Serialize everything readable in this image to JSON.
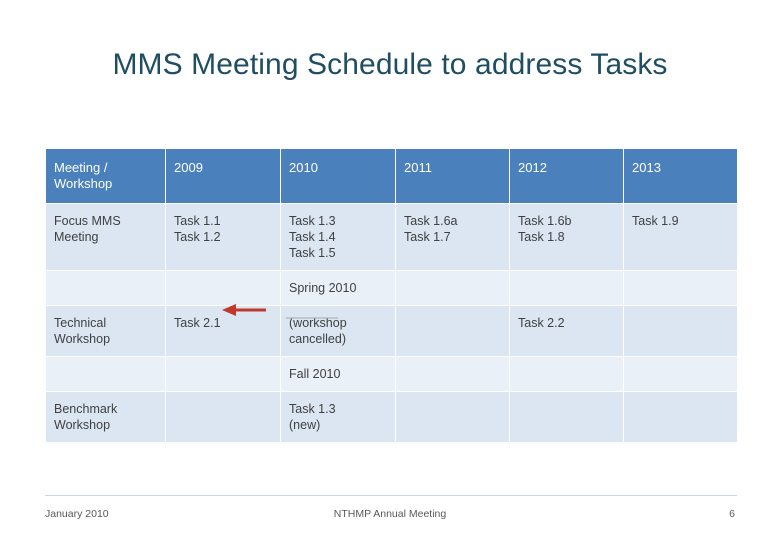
{
  "slide": {
    "title": "MMS Meeting Schedule to address Tasks"
  },
  "table": {
    "headers": [
      "Meeting / Workshop",
      "2009",
      "2010",
      "2011",
      "2012",
      "2013"
    ],
    "rows": [
      {
        "type": "data",
        "cells": [
          "Focus MMS Meeting",
          "Task 1.1\nTask 1.2",
          "Task 1.3\nTask 1.4\nTask 1.5",
          "Task 1.6a\nTask 1.7",
          "Task 1.6b\nTask 1.8",
          "Task 1.9"
        ]
      },
      {
        "type": "label",
        "cells": [
          "",
          "",
          "Spring 2010",
          "",
          "",
          ""
        ]
      },
      {
        "type": "data",
        "cells": [
          "Technical Workshop",
          "Task 2.1",
          "(workshop cancelled)",
          "",
          "Task 2.2",
          ""
        ]
      },
      {
        "type": "label",
        "cells": [
          "",
          "",
          "Fall 2010",
          "",
          "",
          ""
        ]
      },
      {
        "type": "data",
        "cells": [
          "Benchmark Workshop",
          "",
          "Task 1.3\n(new)",
          "",
          "",
          ""
        ]
      }
    ]
  },
  "annotations": {
    "arrow_color": "#c0392b",
    "red_text_color": "#c0392b",
    "cancelled_text_color": "#a6a6a6"
  },
  "footer": {
    "left": "January 2010",
    "center": "NTHMP Annual Meeting",
    "right": "6"
  }
}
